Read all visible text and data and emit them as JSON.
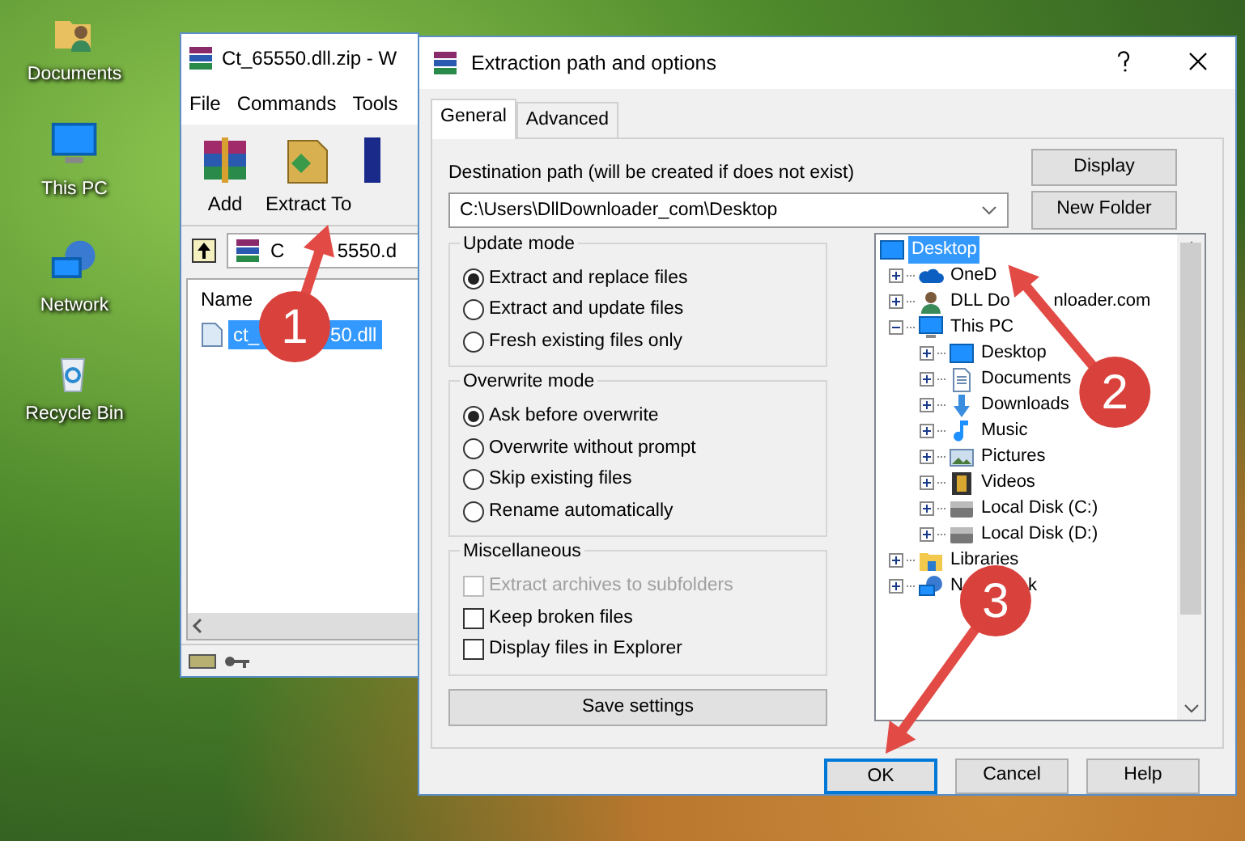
{
  "desktop_icons": [
    {
      "label": "Documents",
      "kind": "user-folder"
    },
    {
      "label": "This PC",
      "kind": "pc"
    },
    {
      "label": "Network",
      "kind": "network"
    },
    {
      "label": "Recycle Bin",
      "kind": "bin"
    }
  ],
  "archive_window": {
    "title": "Ct_65550.dll.zip - W",
    "menu": [
      "File",
      "Commands",
      "Tools"
    ],
    "toolbar": [
      {
        "label": "Add",
        "kind": "add"
      },
      {
        "label": "Extract To",
        "kind": "extract"
      },
      {
        "kind": "book"
      }
    ],
    "address_parts": [
      "C",
      "5550.d"
    ],
    "column_header": "Name",
    "files": [
      {
        "name_parts": [
          "ct_",
          "50.dll"
        ],
        "selected": true
      }
    ]
  },
  "dialog": {
    "title": "Extraction path and options",
    "tabs": [
      {
        "label": "General",
        "selected": true
      },
      {
        "label": "Advanced",
        "selected": false
      }
    ],
    "destination_label": "Destination path (will be created if does not exist)",
    "destination_path": "C:\\Users\\DllDownloader_com\\Desktop",
    "side_buttons": [
      "Display",
      "New Folder"
    ],
    "groups": [
      {
        "title": "Update mode",
        "kind": "radio",
        "options": [
          {
            "label": "Extract and replace files",
            "selected": true
          },
          {
            "label": "Extract and update files",
            "selected": false
          },
          {
            "label": "Fresh existing files only",
            "selected": false
          }
        ]
      },
      {
        "title": "Overwrite mode",
        "kind": "radio",
        "options": [
          {
            "label": "Ask before overwrite",
            "selected": true
          },
          {
            "label": "Overwrite without prompt",
            "selected": false
          },
          {
            "label": "Skip existing files",
            "selected": false
          },
          {
            "label": "Rename automatically",
            "selected": false
          }
        ]
      },
      {
        "title": "Miscellaneous",
        "kind": "check",
        "options": [
          {
            "label": "Extract archives to subfolders",
            "checked": false,
            "disabled": true
          },
          {
            "label": "Keep broken files",
            "checked": false,
            "disabled": false
          },
          {
            "label": "Display files in Explorer",
            "checked": false,
            "disabled": false
          }
        ]
      }
    ],
    "save_button": "Save settings",
    "tree": [
      {
        "label_parts": [
          "Desktop"
        ],
        "kind": "desktop",
        "selected": true,
        "children": [
          {
            "label_parts": [
              "OneD"
            ],
            "kind": "cloud",
            "selected": false,
            "expanded": false
          },
          {
            "label_parts": [
              "DLL Do",
              "nloader.com"
            ],
            "kind": "user",
            "selected": false,
            "expanded": false
          },
          {
            "label_parts": [
              "This PC"
            ],
            "kind": "pc",
            "selected": false,
            "expanded": true,
            "children": [
              {
                "label_parts": [
                  "Desktop"
                ],
                "kind": "desktop",
                "selected": false,
                "expanded": false
              },
              {
                "label_parts": [
                  "Documents"
                ],
                "kind": "document",
                "selected": false,
                "expanded": false
              },
              {
                "label_parts": [
                  "Downloads"
                ],
                "kind": "download",
                "selected": false,
                "expanded": false
              },
              {
                "label_parts": [
                  "Music"
                ],
                "kind": "music",
                "selected": false,
                "expanded": false
              },
              {
                "label_parts": [
                  "Pictures"
                ],
                "kind": "pictures",
                "selected": false,
                "expanded": false
              },
              {
                "label_parts": [
                  "Videos"
                ],
                "kind": "videos",
                "selected": false,
                "expanded": false
              },
              {
                "label_parts": [
                  "Local Disk (C:)"
                ],
                "kind": "drive",
                "selected": false,
                "expanded": false
              },
              {
                "label_parts": [
                  "Local Disk (D:)"
                ],
                "kind": "drive",
                "selected": false,
                "expanded": false
              }
            ]
          },
          {
            "label_parts": [
              "Libraries"
            ],
            "kind": "libraries",
            "selected": false,
            "expanded": false
          },
          {
            "label_parts": [
              "N",
              "k"
            ],
            "kind": "network",
            "selected": false,
            "expanded": false
          }
        ]
      }
    ],
    "buttons": [
      {
        "label": "OK",
        "default": true
      },
      {
        "label": "Cancel",
        "default": false
      },
      {
        "label": "Help",
        "default": false
      }
    ]
  },
  "annotations": [
    {
      "number": "1"
    },
    {
      "number": "2"
    },
    {
      "number": "3"
    }
  ]
}
